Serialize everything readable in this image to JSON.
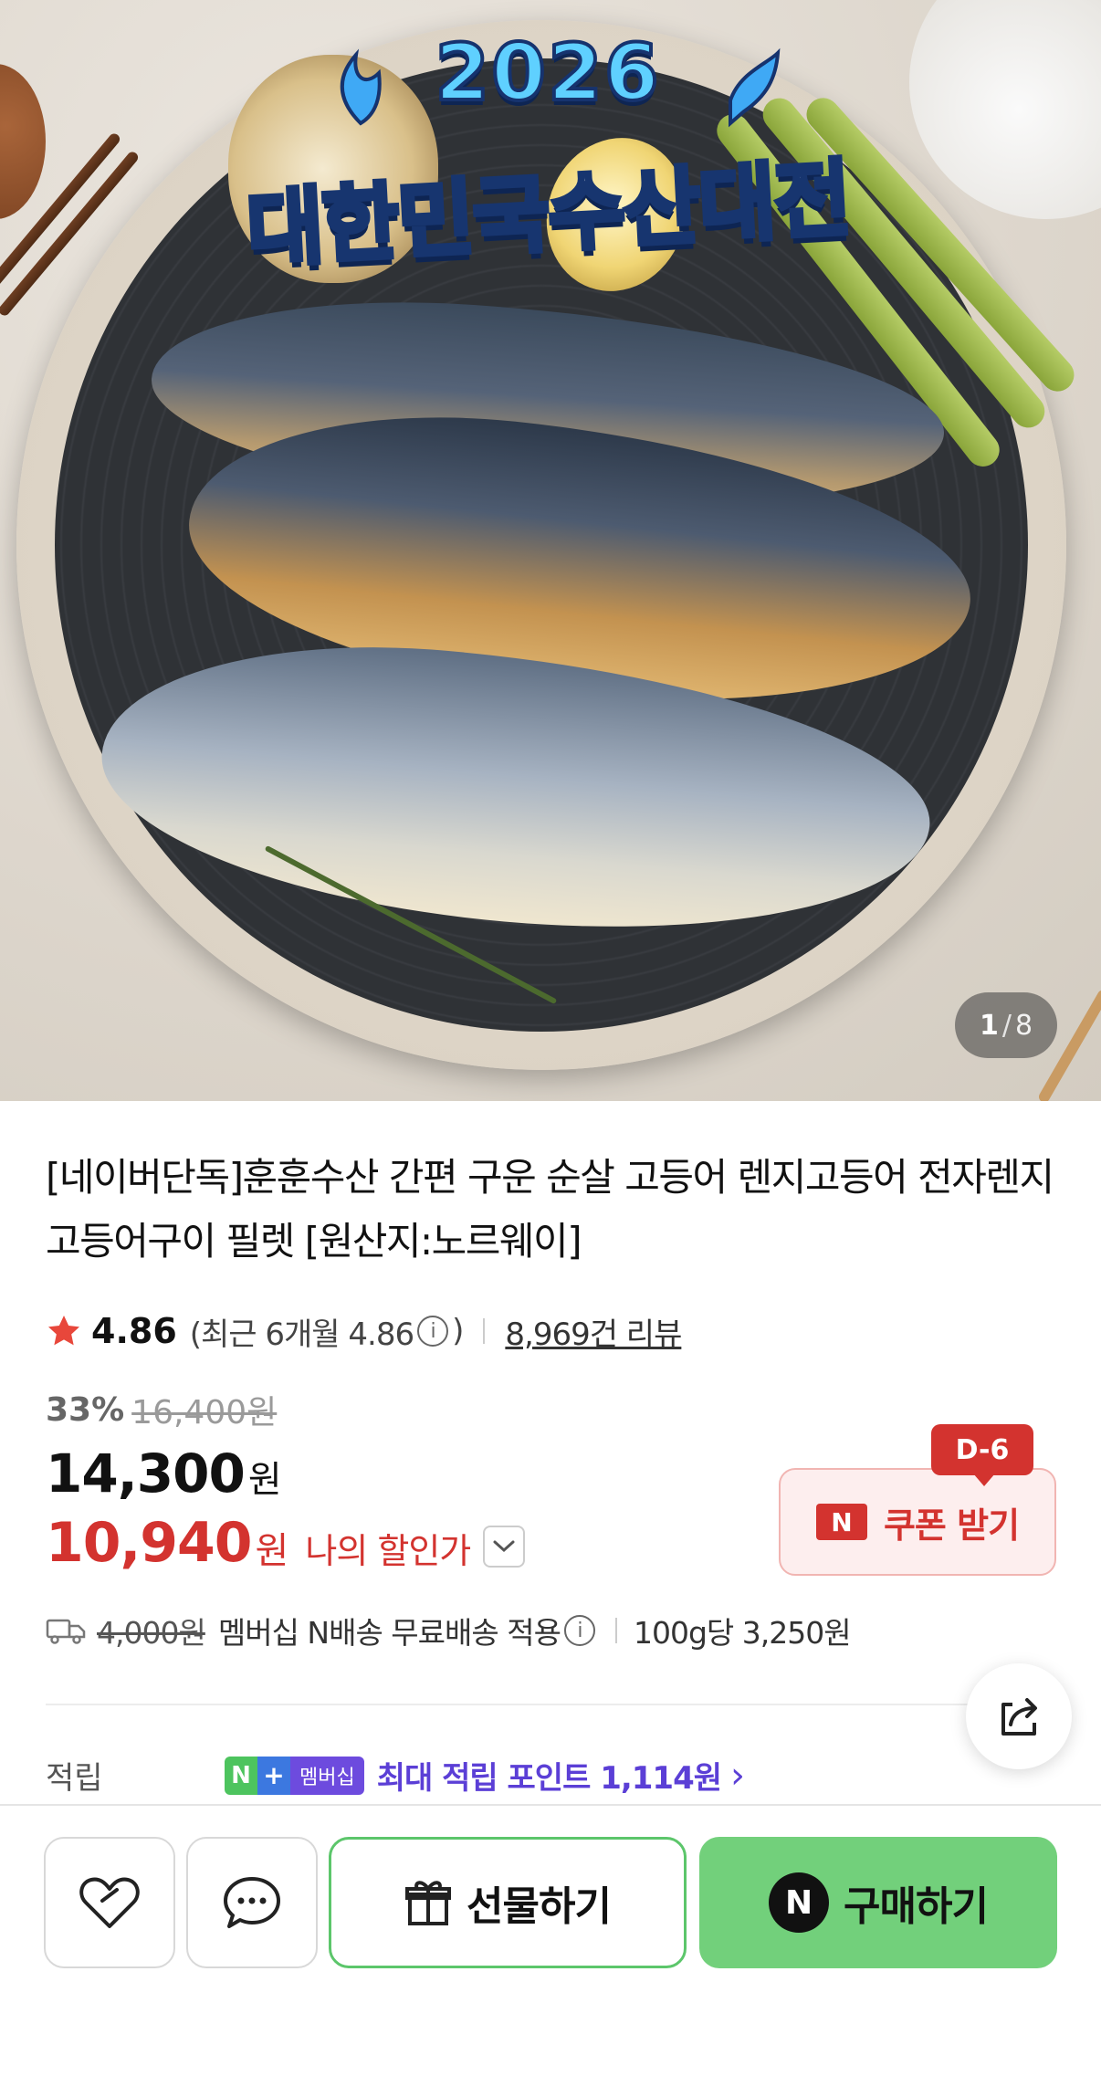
{
  "hero": {
    "banner_year": "2026",
    "banner_title": "대한민국수산대전",
    "counter_current": "1",
    "counter_separator": "/",
    "counter_total": "8"
  },
  "product": {
    "title": "[네이버단독]훈훈수산 간편 구운 순살 고등어 렌지고등어 전자렌지 고등어구이 필렛 [원산지:노르웨이]",
    "rating": "4.86",
    "recent_rating_prefix": "(최근 6개월 4.86",
    "recent_rating_suffix": ")",
    "info_glyph": "i",
    "review_count": "8,969건 리뷰"
  },
  "price": {
    "discount_percent": "33%",
    "original_price": "16,400원",
    "sale_price": "14,300",
    "currency": "원",
    "my_price": "10,940",
    "my_price_label": "나의 할인가"
  },
  "coupon": {
    "dday": "D-6",
    "n_label": "N",
    "label": "쿠폰 받기"
  },
  "shipping": {
    "fee": "4,000원",
    "membership_text": "멤버십 N배송 무료배송 적용",
    "unit_price": "100g당 3,250원"
  },
  "points": {
    "label": "적립",
    "badge_n": "N",
    "badge_plus": "+",
    "badge_membership": "멤버십",
    "text": "최대 적립 포인트 1,114원",
    "arrow": "›"
  },
  "bottom_bar": {
    "gift_label": "선물하기",
    "buy_n": "N",
    "buy_label": "구매하기"
  },
  "colors": {
    "accent_red": "#d3332f",
    "naver_green": "#72d07b",
    "points_purple": "#5b3fd6"
  }
}
